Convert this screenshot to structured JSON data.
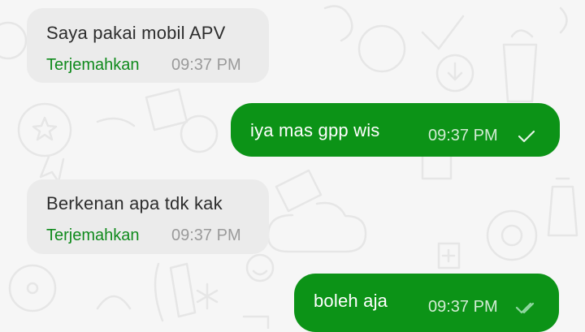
{
  "chat": {
    "messages": [
      {
        "direction": "incoming",
        "text": "Saya pakai mobil APV",
        "translate_label": "Terjemahkan",
        "time": "09:37 PM"
      },
      {
        "direction": "outgoing",
        "text": "iya mas gpp wis",
        "time": "09:37 PM",
        "status": "sent",
        "status_icon": "single-check-icon"
      },
      {
        "direction": "incoming",
        "text": "Berkenan apa tdk kak",
        "translate_label": "Terjemahkan",
        "time": "09:37 PM"
      },
      {
        "direction": "outgoing",
        "text": "boleh aja",
        "time": "09:37 PM",
        "status": "delivered",
        "status_icon": "double-check-icon"
      }
    ]
  },
  "colors": {
    "background": "#f6f6f6",
    "incoming_bubble": "#ebebeb",
    "outgoing_bubble": "#0c9317",
    "translate_link": "#0f8a1c",
    "incoming_time": "#9a9a9a",
    "outgoing_time": "#d2ecd4",
    "delivered_check": "#8fd7a0"
  }
}
